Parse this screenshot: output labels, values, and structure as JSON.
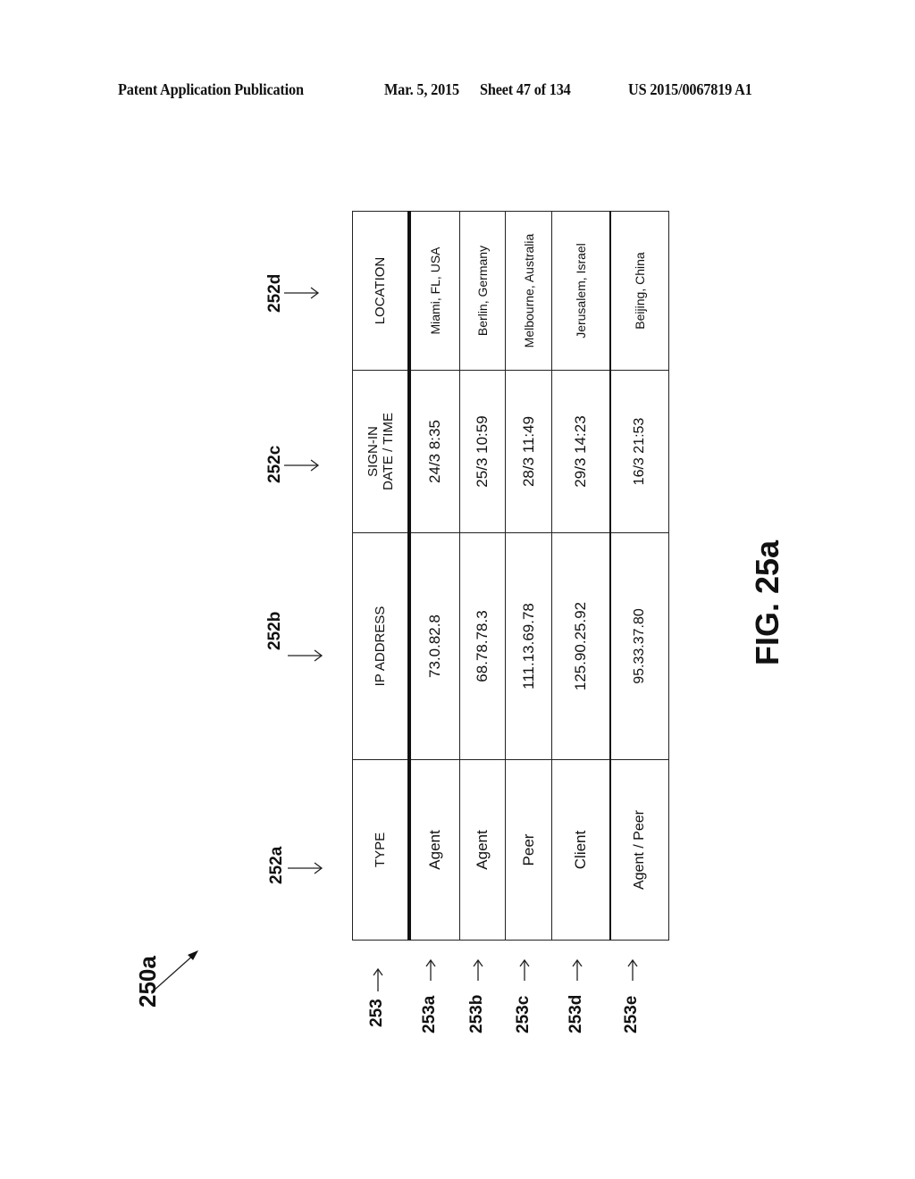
{
  "header": {
    "left": "Patent Application Publication",
    "date": "Mar. 5, 2015",
    "sheet": "Sheet 47 of 134",
    "publication_number": "US 2015/0067819 A1"
  },
  "figure": {
    "label": "FIG. 25a",
    "reference": "250a"
  },
  "table": {
    "columns": [
      {
        "ref": "252a",
        "label": "TYPE"
      },
      {
        "ref": "252b",
        "label": "IP ADDRESS"
      },
      {
        "ref": "252c",
        "label_line1": "SIGN-IN",
        "label_line2": "DATE / TIME"
      },
      {
        "ref": "252d",
        "label": "LOCATION"
      }
    ],
    "header_row_ref": "253",
    "rows": [
      {
        "ref": "253a",
        "type": "Agent",
        "ip": "73.0.82.8",
        "signin": "24/3 8:35",
        "location": "Miami, FL, USA"
      },
      {
        "ref": "253b",
        "type": "Agent",
        "ip": "68.78.78.3",
        "signin": "25/3 10:59",
        "location": "Berlin, Germany"
      },
      {
        "ref": "253c",
        "type": "Peer",
        "ip": "111.13.69.78",
        "signin": "28/3 11:49",
        "location": "Melbourne, Australia"
      },
      {
        "ref": "253d",
        "type": "Client",
        "ip": "125.90.25.92",
        "signin": "29/3 14:23",
        "location": "Jerusalem, Israel"
      },
      {
        "ref": "253e",
        "type": "Agent / Peer",
        "ip": "95.33.37.80",
        "signin": "16/3 21:53",
        "location": "Beijing, China"
      }
    ]
  },
  "arrows": {
    "right": "→",
    "up": "↑"
  }
}
